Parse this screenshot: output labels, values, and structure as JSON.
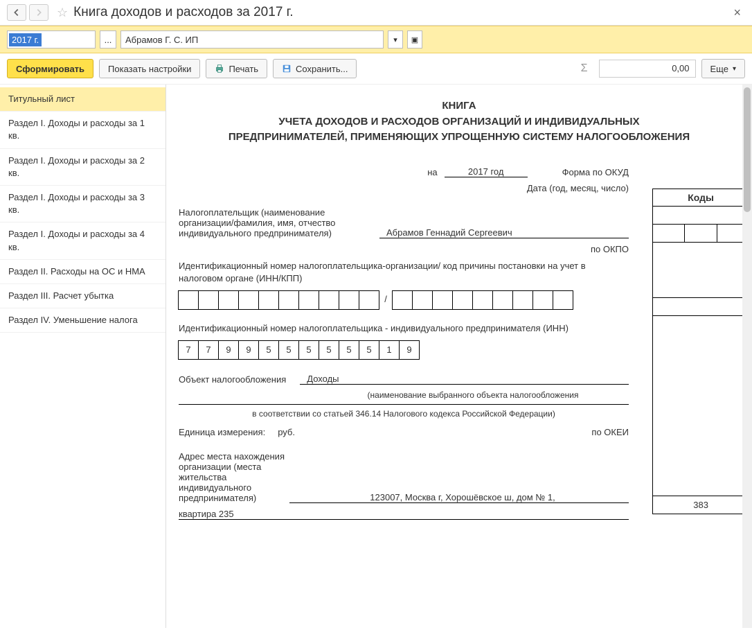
{
  "header": {
    "title": "Книга доходов и расходов за 2017 г."
  },
  "filters": {
    "period": "2017 г.",
    "organization": "Абрамов Г. С. ИП"
  },
  "toolbar": {
    "form": "Сформировать",
    "settings": "Показать настройки",
    "print": "Печать",
    "save": "Сохранить...",
    "sum": "0,00",
    "more": "Еще"
  },
  "sidebar": {
    "items": [
      "Титульный лист",
      "Раздел I. Доходы и расходы за 1 кв.",
      "Раздел I. Доходы и расходы за 2 кв.",
      "Раздел I. Доходы и расходы за 3 кв.",
      "Раздел I. Доходы и расходы за 4 кв.",
      "Раздел II. Расходы на ОС и НМА",
      "Раздел III. Расчет убытка",
      "Раздел IV. Уменьшение налога"
    ]
  },
  "doc": {
    "title_line1": "КНИГА",
    "title_line2": "УЧЕТА ДОХОДОВ И РАСХОДОВ ОРГАНИЗАЦИЙ И ИНДИВИДУАЛЬНЫХ ПРЕДПРИНИМАТЕЛЕЙ, ПРИМЕНЯЮЩИХ УПРОЩЕННУЮ СИСТЕМУ НАЛОГООБЛОЖЕНИЯ",
    "codes_header": "Коды",
    "form_okud": "Форма по ОКУД",
    "year_prefix": "на",
    "year_value": "2017 год",
    "date_label": "Дата (год, месяц, число)",
    "taxpayer_label": "Налогоплательщик (наименование организации/фамилия, имя, отчество индивидуального предпринимателя)",
    "taxpayer_name": "Абрамов Геннадий Сергеевич",
    "okpo_label": "по ОКПО",
    "inn_kpp_label": "Идентификационный номер налогоплательщика-организации/ код причины постановки на учет в налоговом органе (ИНН/КПП)",
    "inn_ip_label": "Идентификационный номер налогоплательщика - индивидуального предпринимателя (ИНН)",
    "inn_digits": [
      "7",
      "7",
      "9",
      "9",
      "5",
      "5",
      "5",
      "5",
      "5",
      "5",
      "1",
      "9"
    ],
    "object_label": "Объект налогообложения",
    "object_value": "Доходы",
    "object_note": "(наименование выбранного объекта налогообложения",
    "law_note": "в соответствии со статьей 346.14 Налогового кодекса Российской Федерации)",
    "unit_label": "Единица измерения:",
    "unit_value": "руб.",
    "okei_label": "по ОКЕИ",
    "okei_value": "383",
    "address_label": "Адрес места нахождения организации (места жительства индивидуального предпринимателя)",
    "address_line1": "123007, Москва г, Хорошёвское ш, дом № 1,",
    "address_line2": "квартира 235"
  }
}
